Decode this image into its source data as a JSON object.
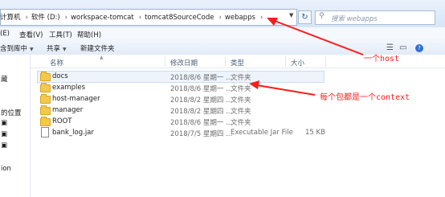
{
  "address": {
    "segments": [
      "计算机",
      "软件 (D:)",
      "workspace-tomcat",
      "tomcat8SourceCode",
      "webapps"
    ],
    "separator": "›",
    "search_placeholder": "搜索 webapps"
  },
  "menu": [
    "查看(V)",
    "工具(T)",
    "帮助(H)"
  ],
  "menu_partial": "(E)",
  "toolbar": {
    "include_library": "含到库中",
    "share": "共享",
    "new_folder": "新建文件夹"
  },
  "nav_items": [
    "藏",
    "的位置",
    "",
    "",
    "",
    "",
    "ion"
  ],
  "columns": {
    "name": "名称",
    "modified": "修改日期",
    "type": "类型",
    "size": "大小"
  },
  "files": [
    {
      "name": "docs",
      "modified": "2018/8/6 星期一 ...",
      "type": "文件夹",
      "size": "",
      "kind": "folder"
    },
    {
      "name": "examples",
      "modified": "2018/8/6 星期一 ...",
      "type": "文件夹",
      "size": "",
      "kind": "folder"
    },
    {
      "name": "host-manager",
      "modified": "2018/8/2 星期四 ...",
      "type": "文件夹",
      "size": "",
      "kind": "folder"
    },
    {
      "name": "manager",
      "modified": "2018/8/2 星期四 ...",
      "type": "文件夹",
      "size": "",
      "kind": "folder"
    },
    {
      "name": "ROOT",
      "modified": "2018/8/6 星期一 ...",
      "type": "文件夹",
      "size": "",
      "kind": "folder"
    },
    {
      "name": "bank_log.jar",
      "modified": "2018/7/5 星期四 ...",
      "type": "Executable Jar File",
      "size": "15 KB",
      "kind": "jar"
    }
  ],
  "annotations": {
    "host": "一个host",
    "context": "每个包都是一个context",
    "color": "#ff1b1b"
  }
}
